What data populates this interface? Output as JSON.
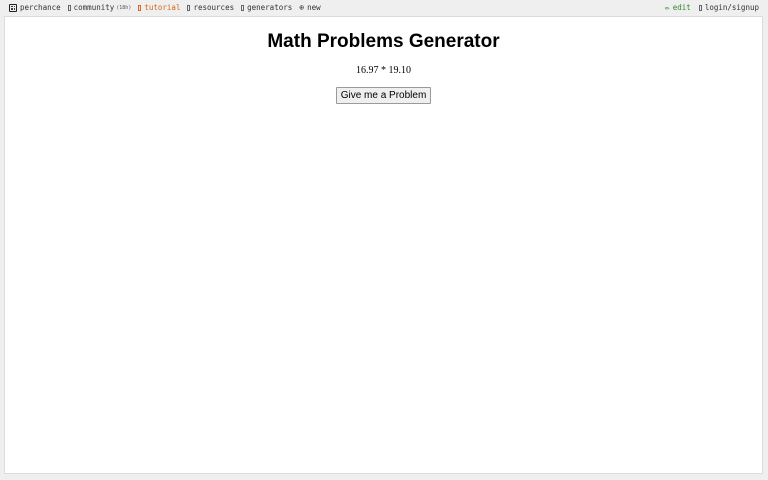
{
  "nav": {
    "brand": "perchance",
    "community": "community",
    "community_badge": "(18h)",
    "tutorial": "tutorial",
    "resources": "resources",
    "generators": "generators",
    "new": "new",
    "edit": "edit",
    "login": "login/signup"
  },
  "colors": {
    "tutorial": "#d2691e",
    "edit": "#2e8b2e"
  },
  "icons": {
    "brand": "dice-icon",
    "community": "chat-icon",
    "tutorial": "book-icon",
    "resources": "resources-icon",
    "generators": "generators-icon",
    "new": "plus-circle-icon",
    "edit": "pencil-icon",
    "login": "user-icon"
  },
  "main": {
    "title": "Math Problems Generator",
    "problem": "16.97 * 19.10",
    "button_label": "Give me a Problem"
  }
}
